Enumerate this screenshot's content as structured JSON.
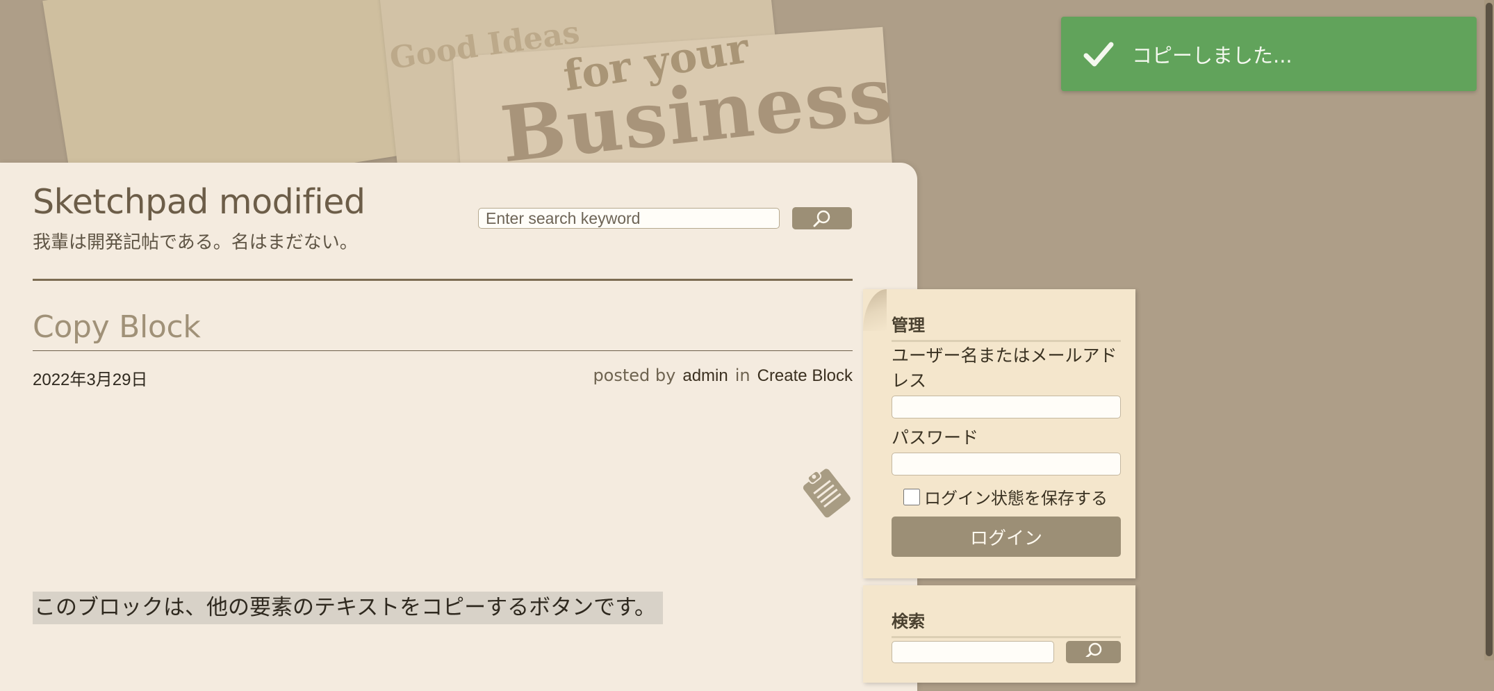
{
  "colors": {
    "background": "#ae9e88",
    "card": "#f4ebdf",
    "accent": "#9c8f76",
    "toast": "#61a35b",
    "widget": "#f4e6cc"
  },
  "header_art": {
    "text_1": "Good Ideas",
    "text_2": "for your",
    "text_3": "Business"
  },
  "site": {
    "title": "Sketchpad modified",
    "tagline": "我輩は開発記帖である。名はまだない。"
  },
  "search": {
    "placeholder": "Enter search keyword",
    "icon": "search-icon"
  },
  "post": {
    "title": "Copy Block",
    "date": "2022年3月29日",
    "posted_by_label": "posted by",
    "author": "admin",
    "in_label": "in",
    "category": "Create Block",
    "body": "このブロックは、他の要素のテキストをコピーするボタンです。",
    "icon": "clipboard-icon"
  },
  "sidebar": {
    "login": {
      "heading": "管理",
      "username_label": "ユーザー名またはメールアドレス",
      "password_label": "パスワード",
      "remember_label": "ログイン状態を保存する",
      "submit_label": "ログイン"
    },
    "search": {
      "heading": "検索",
      "icon": "search-icon"
    }
  },
  "toast": {
    "message": "コピーしました...",
    "icon": "check-icon"
  }
}
